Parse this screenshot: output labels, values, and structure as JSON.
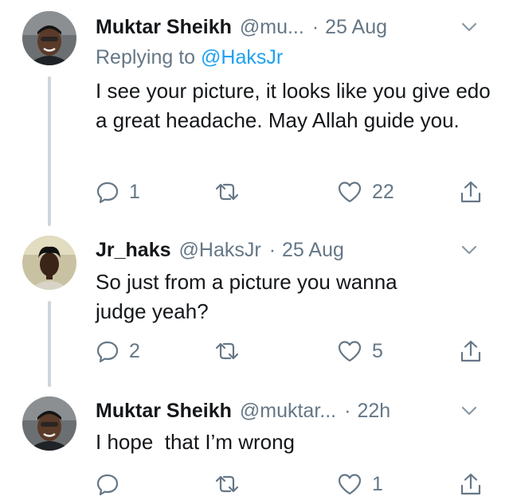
{
  "tweets": [
    {
      "name": "Muktar Sheikh",
      "handle": "@mu...",
      "time": "25 Aug",
      "replying_prefix": "Replying to",
      "replying_handle": "@HaksJr",
      "text": "I see your picture, it looks like you give edo a great headache. May Allah guide you.",
      "replies": "1",
      "retweets": "",
      "likes": "22"
    },
    {
      "name": "Jr_haks",
      "handle": "@HaksJr",
      "time": "25 Aug",
      "text": "So just from a picture you wanna judge yeah?",
      "replies": "2",
      "retweets": "",
      "likes": "5"
    },
    {
      "name": "Muktar Sheikh",
      "handle": "@muktar...",
      "time": "22h",
      "text": "I hope  that I’m wrong",
      "replies": "",
      "retweets": "",
      "likes": "1"
    }
  ],
  "colors": {
    "text": "#14171a",
    "secondary": "#657786",
    "link": "#1da1f2",
    "thread_line": "#cdd6dd"
  },
  "icons": [
    "reply-icon",
    "retweet-icon",
    "like-icon",
    "share-icon",
    "chevron-down-icon"
  ]
}
